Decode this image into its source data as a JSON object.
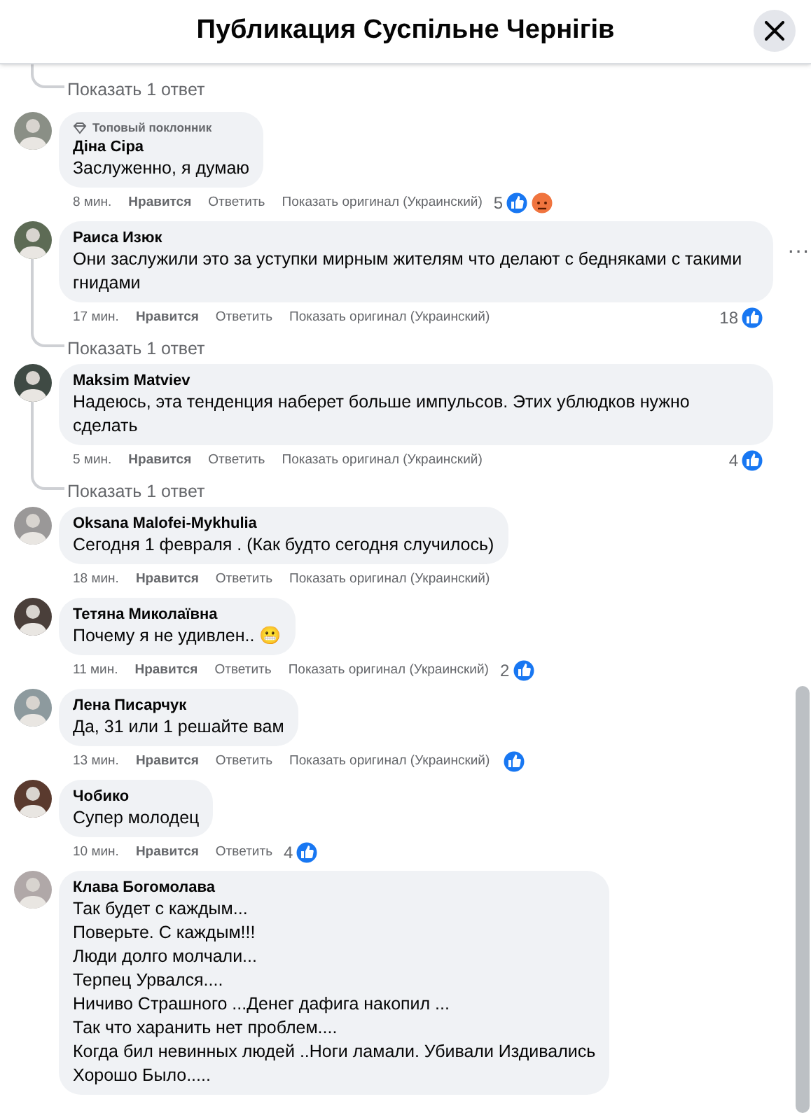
{
  "dialog": {
    "title": "Публикация Суспільне Чернігів"
  },
  "top_thread": {
    "show_replies": "Показать 1 ответ"
  },
  "comments": [
    {
      "author": "Діна Сіра",
      "badge": "Топовый поклонник",
      "text": "Заслуженно, я думаю",
      "time": "8 мин.",
      "like": "Нравится",
      "reply": "Ответить",
      "show_original": "Показать оригинал (Украинский)",
      "reaction_count": "5",
      "reactions": [
        {
          "kind": "like"
        },
        {
          "kind": "angry"
        }
      ]
    },
    {
      "author": "Раиса Изюк",
      "text": "Они заслужили это за уступки мирным жителям что делают с бедняками с такими гнидами",
      "time": "17 мин.",
      "like": "Нравится",
      "reply": "Ответить",
      "show_original": "Показать оригинал (Украинский)",
      "reaction_count": "18",
      "reactions": [
        {
          "kind": "like"
        }
      ],
      "more_menu": "···",
      "show_replies": "Показать 1 ответ"
    },
    {
      "author": "Maksim Matviev",
      "text": "Надеюсь, эта тенденция наберет больше импульсов. Этих ублюдков нужно сделать",
      "time": "5 мин.",
      "like": "Нравится",
      "reply": "Ответить",
      "show_original": "Показать оригинал (Украинский)",
      "reaction_count": "4",
      "reactions": [
        {
          "kind": "like"
        }
      ],
      "show_replies": "Показать 1 ответ"
    },
    {
      "author": "Oksana Malofei-Mykhulia",
      "text": "Сегодня 1 февраля . (Как будто сегодня случилось)",
      "time": "18 мин.",
      "like": "Нравится",
      "reply": "Ответить",
      "show_original": "Показать оригинал (Украинский)"
    },
    {
      "author": "Тетяна Миколаївна",
      "text": "Почему я не удивлен.. 😬",
      "time": "11 мин.",
      "like": "Нравится",
      "reply": "Ответить",
      "show_original": "Показать оригинал (Украинский)",
      "reaction_count": "2",
      "reactions": [
        {
          "kind": "like"
        }
      ]
    },
    {
      "author": "Лена Писарчук",
      "text": "Да, 31 или 1 решайте вам",
      "time": "13 мин.",
      "like": "Нравится",
      "reply": "Ответить",
      "show_original": "Показать оригинал (Украинский)",
      "reactions": [
        {
          "kind": "like"
        }
      ]
    },
    {
      "author": "Чобико",
      "text": "Супер молодец",
      "time": "10 мин.",
      "like": "Нравится",
      "reply": "Ответить",
      "reaction_count": "4",
      "reactions": [
        {
          "kind": "like"
        }
      ]
    },
    {
      "author": "Клава Богомолава",
      "text": "Так будет с каждым...\nПоверьте. С каждым!!!\nЛюди долго молчали...\nТерпец Урвался....\nНичиво Страшного ...Денег дафига накопил ...\nТак что харанить нет проблем....\nКогда бил невинных людей ..Ноги ламали. Убивали Издивались\nХорошо Было....."
    }
  ]
}
